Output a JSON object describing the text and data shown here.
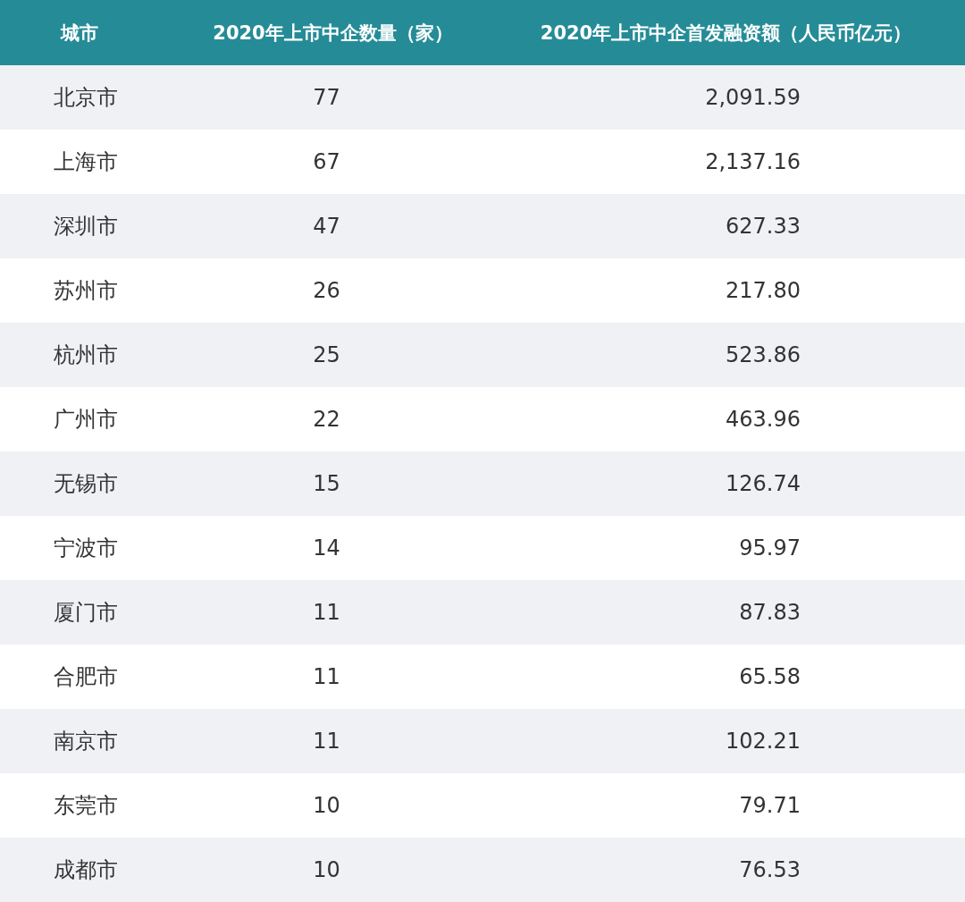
{
  "table": {
    "columns": [
      "城市",
      "2020年上市中企数量（家）",
      "2020年上市中企首发融资额（人民币亿元）"
    ],
    "rows": [
      {
        "city": "北京市",
        "count": "77",
        "amount": "2,091.59"
      },
      {
        "city": "上海市",
        "count": "67",
        "amount": "2,137.16"
      },
      {
        "city": "深圳市",
        "count": "47",
        "amount": "627.33"
      },
      {
        "city": "苏州市",
        "count": "26",
        "amount": "217.80"
      },
      {
        "city": "杭州市",
        "count": "25",
        "amount": "523.86"
      },
      {
        "city": "广州市",
        "count": "22",
        "amount": "463.96"
      },
      {
        "city": "无锡市",
        "count": "15",
        "amount": "126.74"
      },
      {
        "city": "宁波市",
        "count": "14",
        "amount": "95.97"
      },
      {
        "city": "厦门市",
        "count": "11",
        "amount": "87.83"
      },
      {
        "city": "合肥市",
        "count": "11",
        "amount": "65.58"
      },
      {
        "city": "南京市",
        "count": "11",
        "amount": "102.21"
      },
      {
        "city": "东莞市",
        "count": "10",
        "amount": "79.71"
      },
      {
        "city": "成都市",
        "count": "10",
        "amount": "76.53"
      }
    ]
  }
}
